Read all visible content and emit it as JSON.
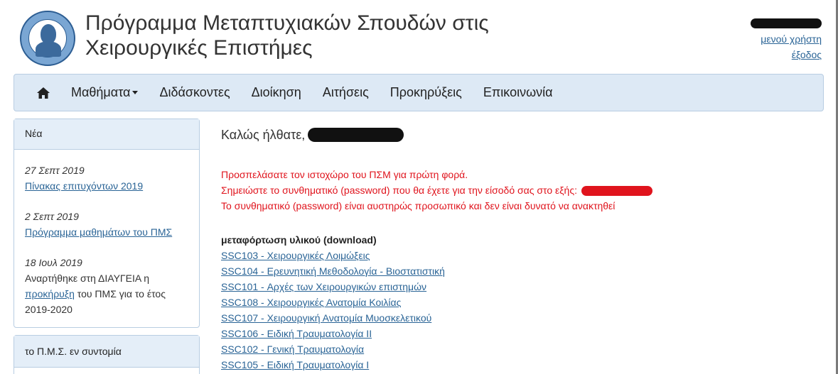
{
  "header": {
    "title_line1": "Πρόγραμμα Μεταπτυχιακών Σπουδών στις",
    "title_line2": "Χειρουργικές Επιστήμες",
    "user_menu_label": "μενού χρήστη",
    "logout_label": "έξοδος"
  },
  "nav": {
    "items": [
      {
        "label": "Μαθήματα",
        "has_dropdown": true
      },
      {
        "label": "Διδάσκοντες"
      },
      {
        "label": "Διοίκηση"
      },
      {
        "label": "Αιτήσεις"
      },
      {
        "label": "Προκηρύξεις"
      },
      {
        "label": "Επικοινωνία"
      }
    ]
  },
  "sidebar": {
    "news_title": "Νέα",
    "news": [
      {
        "date": "27 Σεπτ 2019",
        "link": "Πίνακας επιτυχόντων 2019"
      },
      {
        "date": "2 Σεπτ 2019",
        "link": "Πρόγραμμα μαθημάτων του ΠΜΣ"
      },
      {
        "date": "18 Ιουλ 2019",
        "text_before": "Αναρτήθηκε στη ΔΙΑΥΓΕΙΑ η",
        "link": "προκήρυξη",
        "text_after": "του ΠΜΣ για το έτος 2019-2020"
      }
    ],
    "summary_title": "το Π.Μ.Σ. εν συντομία"
  },
  "main": {
    "welcome": "Καλώς ήλθατε,",
    "warning_line1": "Προσπελάσατε τον ιστοχώρο του ΠΣΜ για πρώτη φορά.",
    "warning_line2": "Σημειώστε το συνθηματικό (password) που θα έχετε για την είσοδό σας στο εξής:",
    "warning_line3": "Το συνθηματικό (password) είναι αυστηρώς προσωπικό και δεν είναι δυνατό να ανακτηθεί",
    "downloads_title": "μεταφόρτωση υλικού (download)",
    "downloads": [
      "SSC103 - Χειρουργικές Λοιμώξεις",
      "SSC104 - Ερευνητική Μεθοδολογία - Βιοστατιστική",
      "SSC101 - Αρχές των Χειρουργικών επιστημών",
      "SSC108 - Χειρουργικές Ανατομία Κοιλίας",
      "SSC107 - Χειρουργική Ανατομία Μυοσκελετικού",
      "SSC106 - Ειδική Τραυματολογία ΙΙ",
      "SSC102 - Γενική Τραυματολογία",
      "SSC105 - Ειδική Τραυματολογία Ι"
    ]
  },
  "colors": {
    "accent_link": "#2a6496",
    "navbar_bg": "#dde9f5",
    "warning_red": "#e0141d"
  }
}
